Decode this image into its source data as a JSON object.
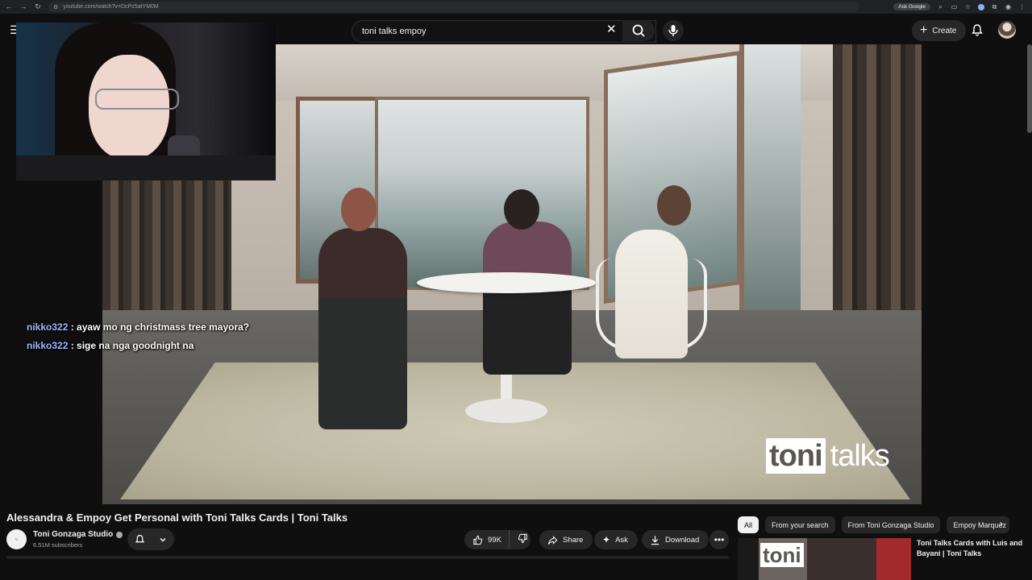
{
  "browser": {
    "url": "youtube.com/watch?v=DcPz5atYM0M",
    "ask_google_label": "Ask Google"
  },
  "masthead": {
    "search_value": "toni talks empoy",
    "create_label": "Create"
  },
  "player": {
    "watermark_part1": "toni",
    "watermark_part2": "talks"
  },
  "chat": [
    {
      "user": "nikko322",
      "message": ": ayaw mo ng christmass tree mayora?"
    },
    {
      "user": "nikko322",
      "message": ": sige na nga goodnight na"
    }
  ],
  "video": {
    "title": "Alessandra & Empoy Get Personal with Toni Talks Cards | Toni Talks",
    "channel_name": "Toni Gonzaga Studio",
    "subscribers": "6.51M subscribers",
    "likes": "99K",
    "share_label": "Share",
    "ask_label": "Ask",
    "download_label": "Download"
  },
  "chips": [
    "All",
    "From your search",
    "From Toni Gonzaga Studio",
    "Empoy Marquez"
  ],
  "recommendation": {
    "title": "Toni Talks Cards with Luis and Bayani | Toni Talks",
    "thumb_text": "toni"
  },
  "colors": {
    "background": "#0f0f0f",
    "chat_username": "#9fb8ff",
    "chip_active": "#f1f1f1"
  }
}
